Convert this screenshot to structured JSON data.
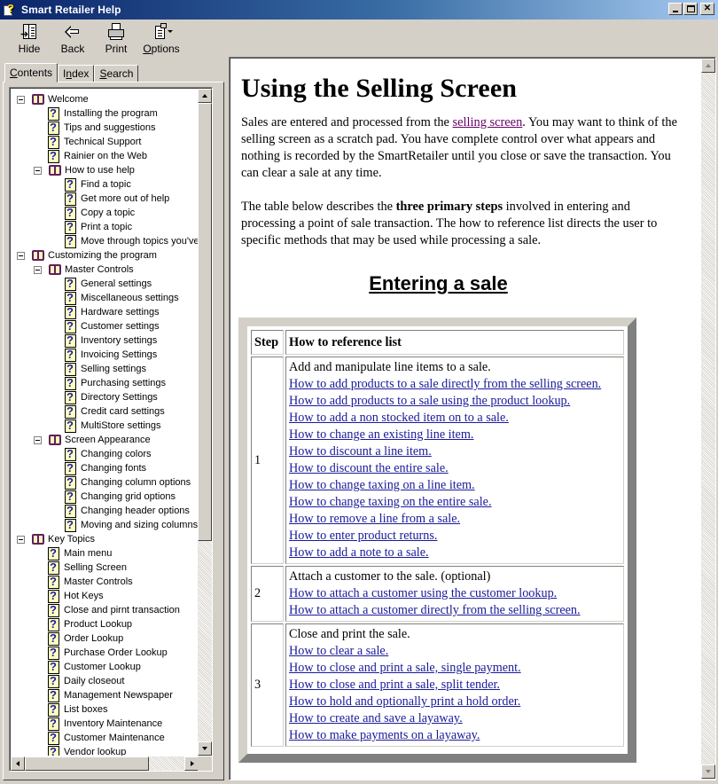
{
  "window": {
    "title": "Smart Retailer Help",
    "controls": [
      "minimize",
      "maximize",
      "close"
    ]
  },
  "toolbar": {
    "buttons": [
      {
        "id": "hide",
        "label": "Hide",
        "icon": "hide-icon"
      },
      {
        "id": "back",
        "label": "Back",
        "icon": "back-arrow-icon"
      },
      {
        "id": "print",
        "label": "Print",
        "icon": "printer-icon"
      },
      {
        "id": "options",
        "label": "Options",
        "icon": "options-icon",
        "accesskey": "O"
      }
    ]
  },
  "nav": {
    "tabs": [
      {
        "label": "Contents",
        "accesskey": "C",
        "active": true
      },
      {
        "label": "Index",
        "accesskey": "n",
        "active": false
      },
      {
        "label": "Search",
        "accesskey": "S",
        "active": false
      }
    ],
    "tree": [
      {
        "type": "book",
        "level": 0,
        "label": "Welcome",
        "expanded": true
      },
      {
        "type": "topic",
        "level": 1,
        "label": "Installing the program"
      },
      {
        "type": "topic",
        "level": 1,
        "label": "Tips and suggestions"
      },
      {
        "type": "topic",
        "level": 1,
        "label": "Technical Support"
      },
      {
        "type": "topic",
        "level": 1,
        "label": "Rainier on the Web"
      },
      {
        "type": "book",
        "level": 1,
        "label": "How to use help",
        "expanded": true
      },
      {
        "type": "topic",
        "level": 2,
        "label": "Find a topic"
      },
      {
        "type": "topic",
        "level": 2,
        "label": "Get more out of help"
      },
      {
        "type": "topic",
        "level": 2,
        "label": "Copy a topic"
      },
      {
        "type": "topic",
        "level": 2,
        "label": "Print a topic"
      },
      {
        "type": "topic",
        "level": 2,
        "label": "Move through topics you've"
      },
      {
        "type": "book",
        "level": 0,
        "label": "Customizing the program",
        "expanded": true
      },
      {
        "type": "book",
        "level": 1,
        "label": "Master Controls",
        "expanded": true
      },
      {
        "type": "topic",
        "level": 2,
        "label": "General settings"
      },
      {
        "type": "topic",
        "level": 2,
        "label": "Miscellaneous settings"
      },
      {
        "type": "topic",
        "level": 2,
        "label": "Hardware settings"
      },
      {
        "type": "topic",
        "level": 2,
        "label": "Customer settings"
      },
      {
        "type": "topic",
        "level": 2,
        "label": "Inventory settings"
      },
      {
        "type": "topic",
        "level": 2,
        "label": "Invoicing Settings"
      },
      {
        "type": "topic",
        "level": 2,
        "label": "Selling settings"
      },
      {
        "type": "topic",
        "level": 2,
        "label": "Purchasing settings"
      },
      {
        "type": "topic",
        "level": 2,
        "label": "Directory Settings"
      },
      {
        "type": "topic",
        "level": 2,
        "label": "Credit card settings"
      },
      {
        "type": "topic",
        "level": 2,
        "label": "MultiStore settings"
      },
      {
        "type": "book",
        "level": 1,
        "label": "Screen Appearance",
        "expanded": true
      },
      {
        "type": "topic",
        "level": 2,
        "label": "Changing colors"
      },
      {
        "type": "topic",
        "level": 2,
        "label": "Changing fonts"
      },
      {
        "type": "topic",
        "level": 2,
        "label": "Changing column options"
      },
      {
        "type": "topic",
        "level": 2,
        "label": "Changing grid options"
      },
      {
        "type": "topic",
        "level": 2,
        "label": "Changing header options"
      },
      {
        "type": "topic",
        "level": 2,
        "label": "Moving and sizing columns"
      },
      {
        "type": "book",
        "level": 0,
        "label": "Key Topics",
        "expanded": true
      },
      {
        "type": "topic",
        "level": 1,
        "label": "Main menu"
      },
      {
        "type": "topic",
        "level": 1,
        "label": "Selling Screen"
      },
      {
        "type": "topic",
        "level": 1,
        "label": "Master Controls"
      },
      {
        "type": "topic",
        "level": 1,
        "label": "Hot Keys"
      },
      {
        "type": "topic",
        "level": 1,
        "label": "Close and pirnt transaction"
      },
      {
        "type": "topic",
        "level": 1,
        "label": "Product Lookup"
      },
      {
        "type": "topic",
        "level": 1,
        "label": "Order Lookup"
      },
      {
        "type": "topic",
        "level": 1,
        "label": "Purchase Order Lookup"
      },
      {
        "type": "topic",
        "level": 1,
        "label": "Customer Lookup"
      },
      {
        "type": "topic",
        "level": 1,
        "label": "Daily closeout"
      },
      {
        "type": "topic",
        "level": 1,
        "label": "Management Newspaper"
      },
      {
        "type": "topic",
        "level": 1,
        "label": "List boxes"
      },
      {
        "type": "topic",
        "level": 1,
        "label": "Inventory Maintenance"
      },
      {
        "type": "topic",
        "level": 1,
        "label": "Customer Maintenance"
      },
      {
        "type": "topic",
        "level": 1,
        "label": "Vendor lookup"
      }
    ]
  },
  "article": {
    "title": "Using the Selling Screen",
    "intro": {
      "before_link": "Sales are entered and processed from the ",
      "link": "selling screen",
      "after_link": ". You may want to think of the selling screen as a scratch pad. You have complete control over what appears and nothing is recorded by the SmartRetailer until you close or save the transaction. You can clear a sale at any time."
    },
    "para2": {
      "before_bold": "The table below describes the ",
      "bold": "three primary steps",
      "after_bold": " involved in entering and processing a point of sale transaction. The how to reference list directs the user to specific methods that may be used while processing a sale."
    },
    "section_title": "Entering a sale",
    "table": {
      "headers": [
        "Step",
        "How to reference list"
      ],
      "rows": [
        {
          "step": "1",
          "description": "Add and manipulate line items to a sale.",
          "links": [
            "How to add products to a sale directly from the selling screen.",
            "How to add products to a sale using the product lookup.",
            "How to add a non stocked item on to a sale.",
            "How to change an existing line item.",
            "How to discount a line item.",
            "How to discount the entire sale.",
            "How to change taxing on a line item.",
            "How to change taxing on the entire sale.",
            "How to remove a line from a sale.",
            "How to enter product returns.",
            "How to add a note to a sale."
          ]
        },
        {
          "step": "2",
          "description": "Attach a customer to the sale. (optional)",
          "links": [
            "How to attach a customer using the customer lookup.",
            "How to attach a customer directly from the selling screen."
          ]
        },
        {
          "step": "3",
          "description": "Close and print the sale.",
          "links": [
            "How to clear a sale.",
            "How to close and print a sale, single payment.",
            "How to close and print a sale, split tender.",
            "How to hold and optionally print a hold order.",
            "How to create and save a layaway.",
            "How to make payments on a layaway."
          ]
        }
      ]
    }
  },
  "colors": {
    "titlebar_start": "#0a246a",
    "titlebar_end": "#a6caf0",
    "chrome": "#d4d0c8",
    "link": "#1a1a9a",
    "visited_link": "#660066",
    "book_icon": "#60205a",
    "topic_icon_bg": "#ffffc0"
  }
}
